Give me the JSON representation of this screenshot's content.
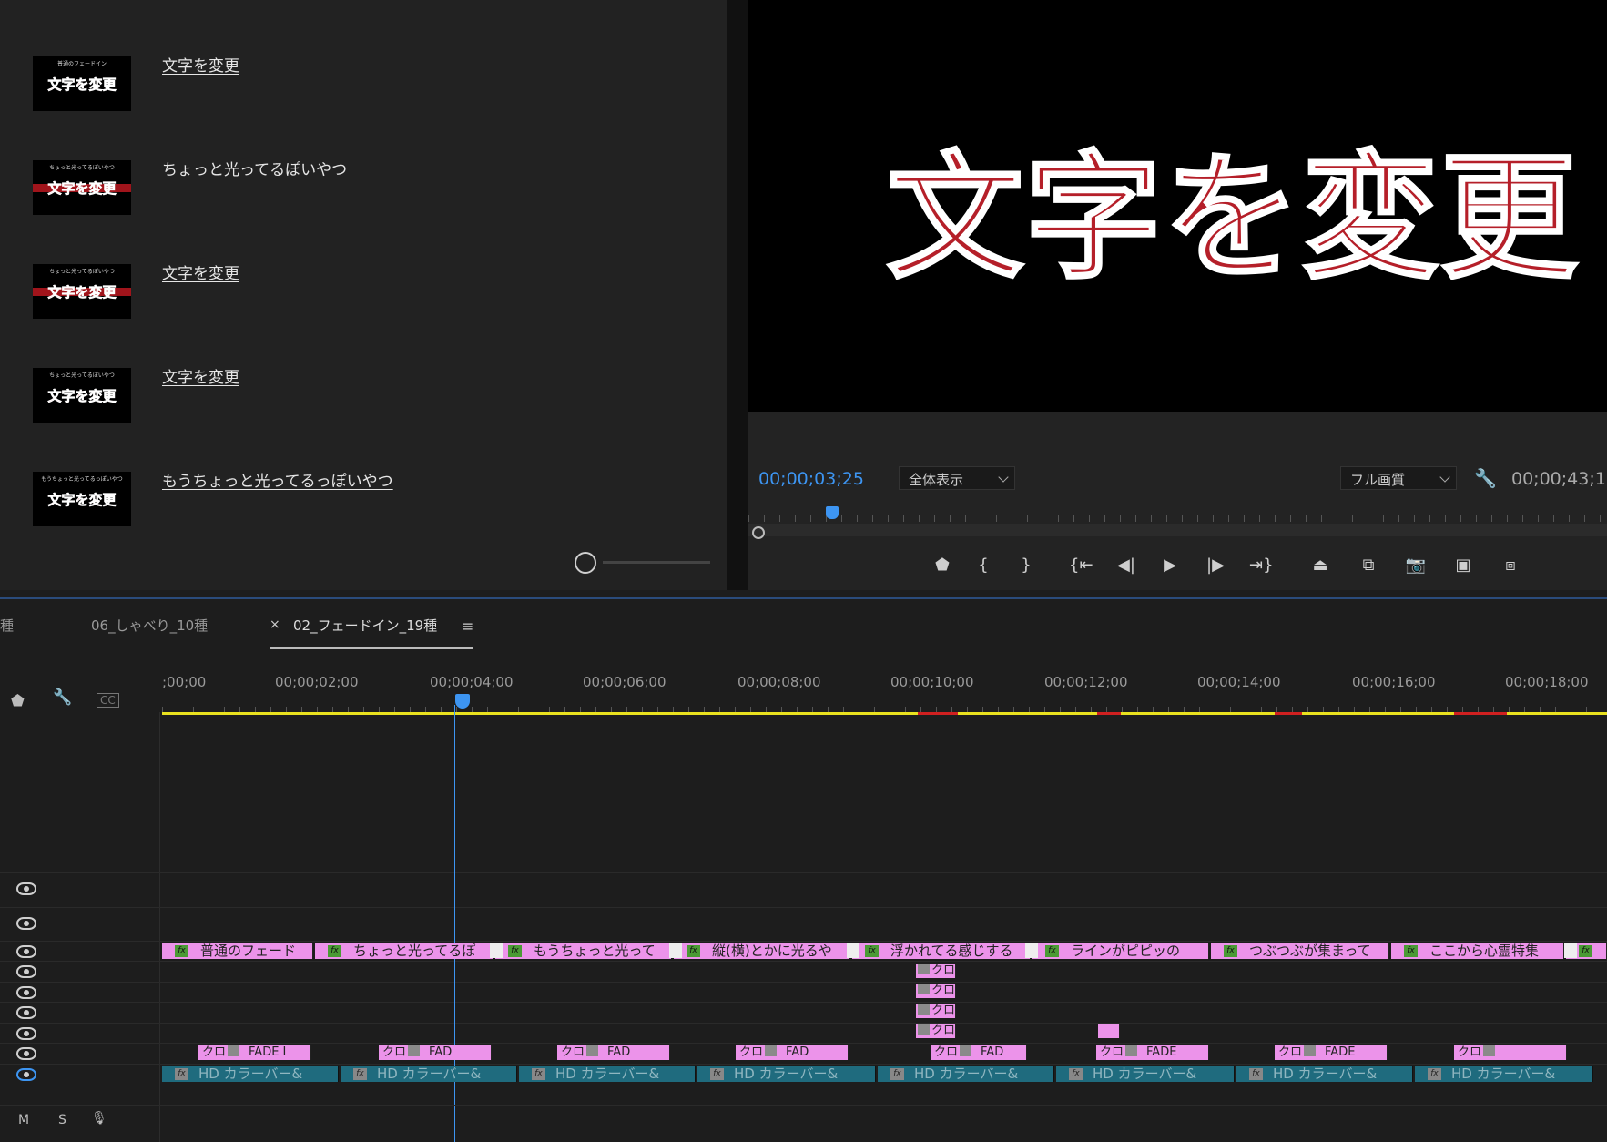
{
  "project_list": {
    "items": [
      {
        "label": "文字を変更",
        "thumb_small": "普通のフェードイン",
        "thumb_big": "文字を変更",
        "band": false
      },
      {
        "label": "ちょっと光ってるぽいやつ",
        "thumb_small": "ちょっと光ってるぽいやつ",
        "thumb_big": "文字を変更",
        "band": true
      },
      {
        "label": "文字を変更",
        "thumb_small": "ちょっと光ってるぽいやつ",
        "thumb_big": "文字を変更",
        "band": true
      },
      {
        "label": "文字を変更",
        "thumb_small": "ちょっと光ってるぽいやつ",
        "thumb_big": "文字を変更",
        "band": false
      },
      {
        "label": "もうちょっと光ってるっぽいやつ",
        "thumb_small": "もうちょっと光ってるっぽいやつ",
        "thumb_big": "文字を変更",
        "band": false
      }
    ]
  },
  "program_monitor": {
    "preview_text": "文字を変更",
    "current_timecode": "00;00;03;25",
    "zoom_select": "全体表示",
    "quality_select": "フル画質",
    "duration_timecode": "00;00;43;1",
    "playhead_fraction": 0.09,
    "transport": [
      "marker-icon",
      "mark-in-icon",
      "mark-out-icon",
      "go-to-in-icon",
      "step-back-icon",
      "play-icon",
      "step-forward-icon",
      "go-to-out-icon",
      "lift-icon",
      "extract-icon",
      "export-frame-icon",
      "insert-icon",
      "overwrite-icon"
    ]
  },
  "timeline": {
    "tabs": [
      {
        "label": "種"
      },
      {
        "label": "06_しゃべり_10種"
      },
      {
        "label": "02_フェードイン_19種",
        "active": true
      }
    ],
    "close_glyph": "×",
    "menu_glyph": "≡",
    "ruler_labels": [
      ";00;00",
      "00;00;02;00",
      "00;00;04;00",
      "00;00;06;00",
      "00;00;08;00",
      "00;00;10;00",
      "00;00;12;00",
      "00;00;14;00",
      "00;00;16;00",
      "00;00;18;00"
    ],
    "caption_icon": "CC",
    "v_track_clips": [
      "普通のフェード",
      "ちょっと光ってるぽ",
      "もうちょっと光って",
      "縦(横)とかに光るや",
      "浮かれてる感じする",
      "ラインがピピッの",
      "つぶつぶが集まって",
      "ここから心霊特集",
      ""
    ],
    "fade_clips": [
      "FADE I",
      "FAD",
      "FAD",
      "FAD",
      "FAD",
      "FADE",
      "FADE",
      ""
    ],
    "fade_prefix": "クロ",
    "v1_clips": [
      "HD カラーバー&",
      "HD カラーバー&",
      "HD カラーバー&",
      "HD カラーバー&",
      "HD カラーバー&",
      "HD カラーバー&",
      "HD カラーバー&",
      "HD カラーバー&"
    ],
    "fx_label": "fx",
    "audio_controls": {
      "mute": "M",
      "solo": "S"
    },
    "colors": {
      "clip_pink": "#ec93ea",
      "clip_teal": "#1f6b7e",
      "playhead": "#3d95f2",
      "work_area": "#e9e11f"
    }
  }
}
